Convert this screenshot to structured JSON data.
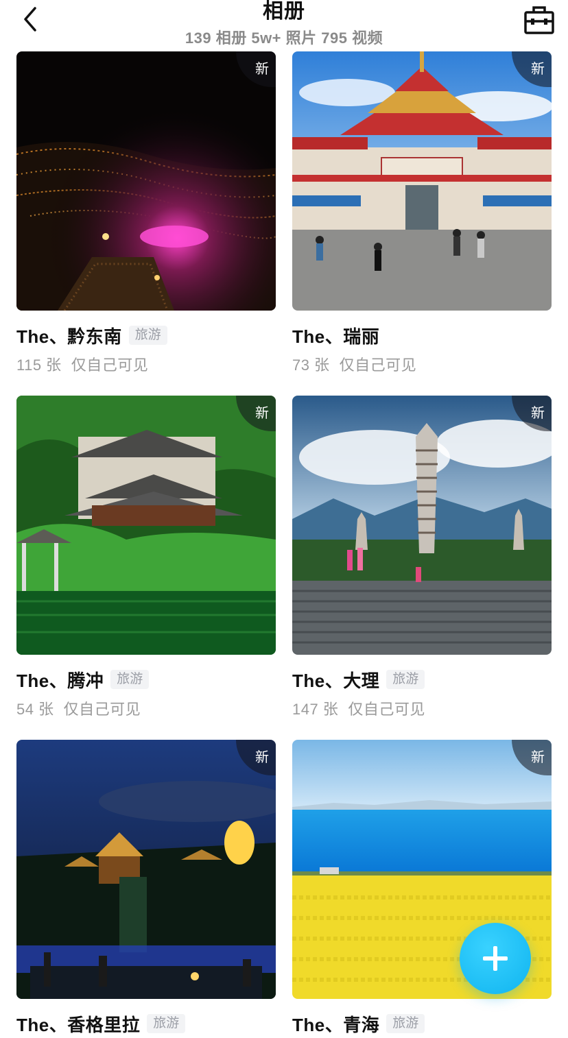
{
  "header": {
    "title": "相册",
    "subtitle": "139 相册  5w+ 照片  795 视频",
    "back_icon": "chevron-left-icon",
    "tool_icon": "toolbox-icon"
  },
  "albums": [
    {
      "name": "The、黔东南",
      "tag": "旅游",
      "count": "115 张",
      "visibility": "仅自己可见",
      "badge": "新"
    },
    {
      "name": "The、瑞丽",
      "tag": "",
      "count": "73 张",
      "visibility": "仅自己可见",
      "badge": "新"
    },
    {
      "name": "The、腾冲",
      "tag": "旅游",
      "count": "54 张",
      "visibility": "仅自己可见",
      "badge": "新"
    },
    {
      "name": "The、大理",
      "tag": "旅游",
      "count": "147 张",
      "visibility": "仅自己可见",
      "badge": "新"
    },
    {
      "name": "The、香格里拉",
      "tag": "旅游",
      "count": "",
      "visibility": "",
      "badge": "新"
    },
    {
      "name": "The、青海",
      "tag": "旅游",
      "count": "",
      "visibility": "",
      "badge": "新"
    }
  ],
  "fab": {
    "icon": "plus-icon"
  },
  "colors": {
    "accent": "#18bdf5",
    "text": "#111111",
    "muted": "#9a9a9a"
  }
}
